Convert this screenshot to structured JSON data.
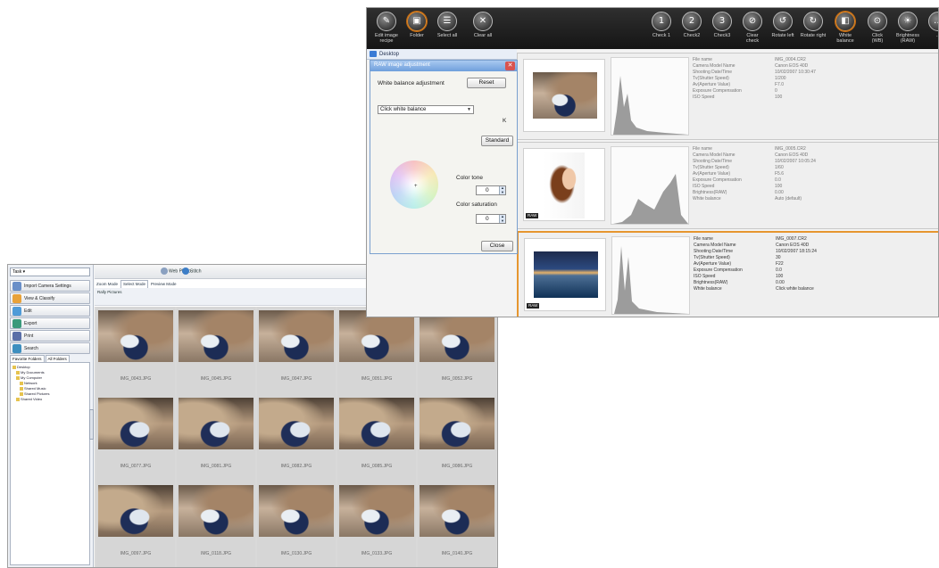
{
  "right_window": {
    "toolbar": [
      {
        "label": "Edit image\nrecipe",
        "icon": "edit-recipe-icon",
        "glyph": "✎",
        "highlight": false
      },
      {
        "label": "Folder",
        "icon": "folder-icon",
        "glyph": "▣",
        "highlight": true
      },
      {
        "label": "Select all",
        "icon": "select-all-icon",
        "glyph": "☰",
        "highlight": false
      },
      {
        "label": "Clear all",
        "icon": "clear-all-icon",
        "glyph": "✕",
        "highlight": false
      },
      {
        "label": "Check 1",
        "icon": "check1-icon",
        "glyph": "1",
        "highlight": false
      },
      {
        "label": "Check2",
        "icon": "check2-icon",
        "glyph": "2",
        "highlight": false
      },
      {
        "label": "Check3",
        "icon": "check3-icon",
        "glyph": "3",
        "highlight": false
      },
      {
        "label": "Clear\ncheck",
        "icon": "clear-check-icon",
        "glyph": "⊘",
        "highlight": false
      },
      {
        "label": "Rotate left",
        "icon": "rotate-left-icon",
        "glyph": "↺",
        "highlight": false
      },
      {
        "label": "Rotate right",
        "icon": "rotate-right-icon",
        "glyph": "↻",
        "highlight": false
      },
      {
        "label": "White\nbalance",
        "icon": "white-balance-icon",
        "glyph": "◧",
        "highlight": true
      },
      {
        "label": "Click\n(WB)",
        "icon": "click-wb-icon",
        "glyph": "⊙",
        "highlight": false
      },
      {
        "label": "Brightness\n(RAW)",
        "icon": "brightness-icon",
        "glyph": "☀",
        "highlight": false
      },
      {
        "label": "...",
        "icon": "more-icon",
        "glyph": "…",
        "highlight": false
      }
    ],
    "file_strip_label": "Desktop",
    "wb_dialog": {
      "title": "RAW image adjustment",
      "heading": "White balance adjustment",
      "reset_label": "Reset",
      "select_value": "Click white balance",
      "k_label": "K",
      "standard_label": "Standard",
      "color_tone_label": "Color tone",
      "color_tone_value": "0",
      "color_saturation_label": "Color saturation",
      "color_saturation_value": "0",
      "close_label": "Close"
    },
    "rows": [
      {
        "type": "rally",
        "selected": false,
        "raw_badge": "",
        "info": [
          [
            "File name",
            "IMG_0004.CR2"
          ],
          [
            "Camera Model Name",
            "Canon EOS 40D"
          ],
          [
            "Shooting Date/Time",
            "10/02/2007 10:30:47"
          ],
          [
            "Tv(Shutter Speed)",
            "1/200"
          ],
          [
            "Av(Aperture Value)",
            "F7.0"
          ],
          [
            "Exposure Compensation",
            "0"
          ],
          [
            "ISO Speed",
            "100"
          ]
        ]
      },
      {
        "type": "portrait",
        "selected": false,
        "raw_badge": "RAW",
        "info": [
          [
            "File name",
            "IMG_0005.CR2"
          ],
          [
            "Camera Model Name",
            "Canon EOS 40D"
          ],
          [
            "Shooting Date/Time",
            "10/02/2007 10:05:24"
          ],
          [
            "Tv(Shutter Speed)",
            "1/60"
          ],
          [
            "Av(Aperture Value)",
            "F5.6"
          ],
          [
            "Exposure Compensation",
            "0.0"
          ],
          [
            "ISO Speed",
            "100"
          ],
          [
            "Brightness(RAW)",
            "0.00"
          ],
          [
            "White balance",
            "Auto (default)"
          ]
        ]
      },
      {
        "type": "coast",
        "selected": true,
        "raw_badge": "RAW",
        "info": [
          [
            "File name",
            "IMG_0007.CR2"
          ],
          [
            "Camera Model Name",
            "Canon EOS 40D"
          ],
          [
            "Shooting Date/Time",
            "10/02/2007 18:15:24"
          ],
          [
            "Tv(Shutter Speed)",
            "30"
          ],
          [
            "Av(Aperture Value)",
            "F22"
          ],
          [
            "Exposure Compensation",
            "0.0"
          ],
          [
            "ISO Speed",
            "100"
          ],
          [
            "Brightness(RAW)",
            "0.00"
          ],
          [
            "White balance",
            "Click white balance"
          ]
        ]
      }
    ]
  },
  "left_window": {
    "task_select_value": "Task ▾",
    "task_items": [
      {
        "label": "Import Camera Settings",
        "color": "#6a8fc8"
      },
      {
        "label": "View & Classify",
        "color": "#e8a23a"
      },
      {
        "label": "Edit",
        "color": "#4f9bd8"
      },
      {
        "label": "Export",
        "color": "#3a9a7b"
      },
      {
        "label": "Print",
        "color": "#5a6fa8"
      },
      {
        "label": "Search",
        "color": "#3e8fbf"
      }
    ],
    "folder_tabs": [
      "Favorite Folders",
      "All Folders"
    ],
    "folder_tree": [
      "Desktop",
      "My Documents",
      "My Computer",
      "Network",
      "Shared Music",
      "Shared Pictures",
      "Shared Video"
    ],
    "toolbar": [
      {
        "label": "Web Photo",
        "icon": "web-photo-icon",
        "color": "#8aa0c0"
      },
      {
        "label": "Stitch",
        "icon": "stitch-icon",
        "color": "#3d7ec7"
      }
    ],
    "mode_tabs": [
      {
        "label": "Zoom Mode",
        "active": false
      },
      {
        "label": "Select Mode",
        "active": true
      },
      {
        "label": "Preview Mode",
        "active": false
      }
    ],
    "path_label": "Rally Pictures",
    "view_controls": {
      "sort_label": "Sort",
      "show_label": "Show",
      "show_value": "All images"
    },
    "thumbnails": [
      {
        "name": "IMG_0043.JPG",
        "style": "rally"
      },
      {
        "name": "IMG_0045.JPG",
        "style": "rally"
      },
      {
        "name": "IMG_0047.JPG",
        "style": "rally"
      },
      {
        "name": "IMG_0051.JPG",
        "style": "rally"
      },
      {
        "name": "IMG_0052.JPG",
        "style": "rally"
      },
      {
        "name": "IMG_0077.JPG",
        "style": "rally2"
      },
      {
        "name": "IMG_0081.JPG",
        "style": "rally2"
      },
      {
        "name": "IMG_0082.JPG",
        "style": "rally2"
      },
      {
        "name": "IMG_0085.JPG",
        "style": "rally2"
      },
      {
        "name": "IMG_0086.JPG",
        "style": "rally2"
      },
      {
        "name": "IMG_0097.JPG",
        "style": "rally2"
      },
      {
        "name": "IMG_0118.JPG",
        "style": "rally"
      },
      {
        "name": "IMG_0130.JPG",
        "style": "rally"
      },
      {
        "name": "IMG_0133.JPG",
        "style": "rally"
      },
      {
        "name": "IMG_0140.JPG",
        "style": "rally"
      }
    ]
  }
}
